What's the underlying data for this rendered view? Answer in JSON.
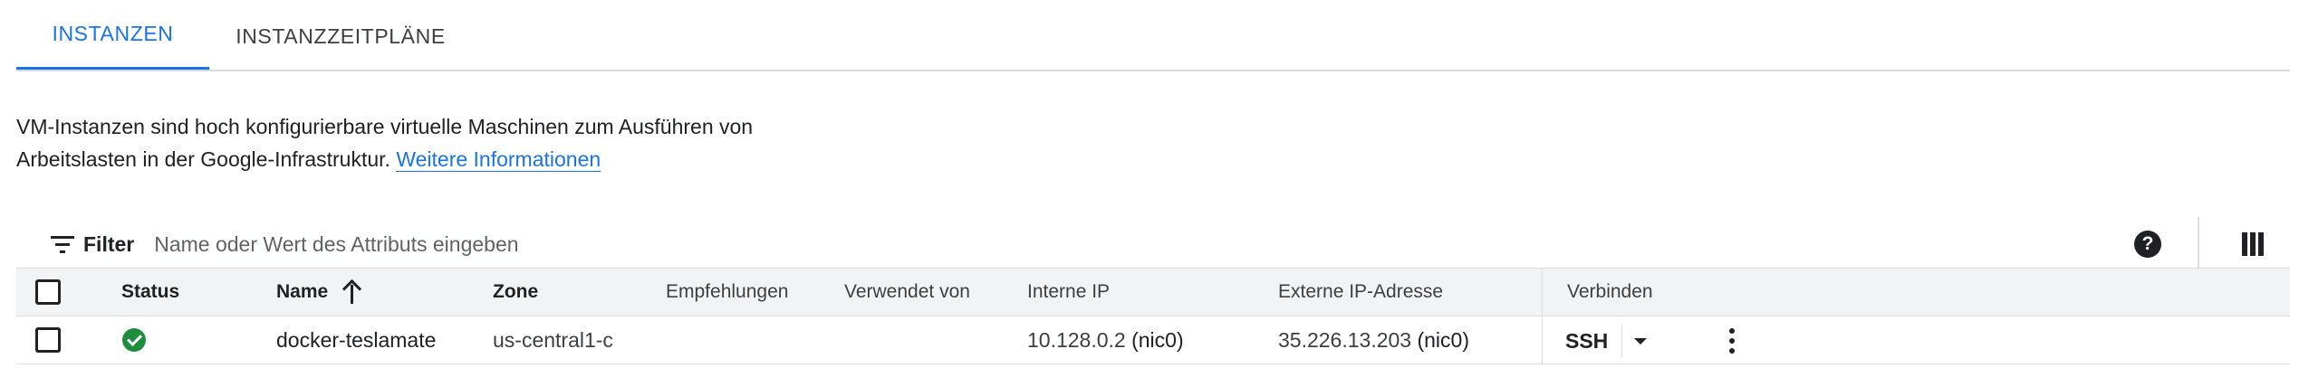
{
  "tabs": [
    {
      "label": "INSTANZEN",
      "active": true
    },
    {
      "label": "INSTANZZEITPLÄNE",
      "active": false
    }
  ],
  "description": {
    "line1": "VM-Instanzen sind hoch konfigurierbare virtuelle Maschinen zum Ausführen von",
    "line2": "Arbeitslasten in der Google-Infrastruktur.",
    "link": "Weitere Informationen"
  },
  "filter": {
    "label": "Filter",
    "placeholder": "Name oder Wert des Attributs eingeben",
    "value": ""
  },
  "toolbar": {
    "help_glyph": "?",
    "help_icon": "help-icon",
    "columns_icon": "column-display-icon"
  },
  "table": {
    "columns": {
      "status": "Status",
      "name": "Name",
      "zone": "Zone",
      "recommendations": "Empfehlungen",
      "used_by": "Verwendet von",
      "internal_ip": "Interne IP",
      "external_ip": "Externe IP-Adresse",
      "connect": "Verbinden"
    },
    "sort": {
      "column": "Name",
      "direction": "ascending"
    },
    "rows": [
      {
        "status": "running",
        "name": "docker-teslamate",
        "zone": "us-central1-c",
        "recommendations": "",
        "used_by": "",
        "internal_ip": "10.128.0.2",
        "internal_nic": "(nic0)",
        "external_ip": "35.226.13.203",
        "external_nic": "(nic0)",
        "connect_label": "SSH"
      }
    ]
  },
  "colors": {
    "accent": "#1a73e8",
    "status_ok": "#1e8e3e",
    "header_bg": "#f1f3f4",
    "divider": "#dadce0"
  }
}
